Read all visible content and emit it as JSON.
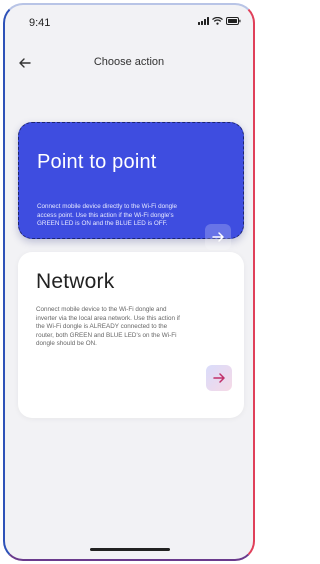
{
  "status_bar": {
    "time": "9:41",
    "icons": [
      "signal-icon",
      "wifi-icon",
      "battery-icon"
    ]
  },
  "header": {
    "title": "Choose action",
    "back_icon": "arrow-left-icon"
  },
  "cards": {
    "point_to_point": {
      "title": "Point to point",
      "description": "Connect mobile device directly to the Wi-Fi dongle access point. Use this action if the Wi-Fi dongle's GREEN LED is ON and the BLUE LED is OFF.",
      "action_icon": "arrow-right-icon"
    },
    "network": {
      "title": "Network",
      "description": "Connect mobile device to the Wi-Fi dongle and inverter via the local area network. Use this action if the Wi-Fi dongle is ALREADY connected to the router, both GREEN and BLUE LED's on the Wi-Fi dongle should be ON.",
      "action_icon": "arrow-right-icon"
    }
  },
  "colors": {
    "primary_card": "#3e4de0",
    "background": "#f2f2f5",
    "network_arrow": "#c0306a"
  }
}
